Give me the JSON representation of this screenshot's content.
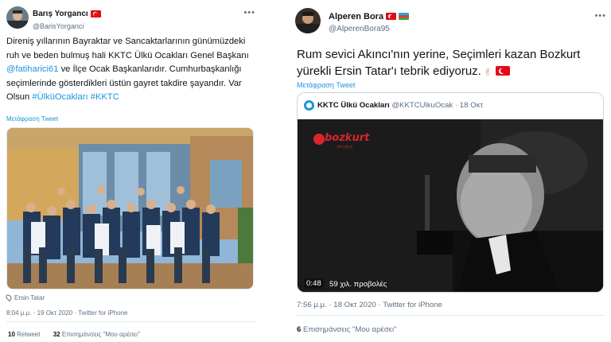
{
  "tweet1": {
    "display_name": "Barış Yorgancı",
    "handle": "@BarisYorganci",
    "text_parts": [
      "Direniş yıllarının Bayraktar ve Sancaktarlarının günümüzdeki ruh ve beden bulmuş hali KKTC Ülkü Ocakları Genel Başkanı ",
      "@fatiharici61",
      " ve İlçe Ocak Başkanlarıdır. Cumhurbaşkanlığı seçimlerinde gösterdikleri üstün gayret takdire şayandır. Var Olsun ",
      "#ÜlküOcakları",
      " ",
      "#KKTC"
    ],
    "translate_label": "Μετάφραση Tweet",
    "place": "Ersin Tatar",
    "time": "8:04 μ.μ.",
    "date": "19 Οκτ 2020",
    "source": "Twitter for iPhone",
    "retweets_count": "10",
    "retweets_label": "Retweet",
    "likes_count": "32",
    "likes_label": "Επισημάνσεις \"Μου αρέσει\""
  },
  "tweet2": {
    "display_name": "Alperen Bora",
    "handle": "@AlperenBora95",
    "text_line1": "Rum sevici Akıncı'nın yerine, Seçimleri kazan Bozkurt",
    "text_line2": "yürekli Ersin Tatar'ı tebrik ediyoruz.",
    "translate_label": "Μετάφραση Tweet",
    "quote": {
      "display_name": "KKTC Ülkü Ocakları",
      "handle": "@KKTCUlkuOcak",
      "date": "18 Οκτ",
      "video_logo": "bozkurt",
      "video_logo_sub": "medya",
      "video_time": "0:48",
      "video_views": "59 χιλ. προβολές"
    },
    "time": "7:56 μ.μ.",
    "date": "18 Οκτ 2020",
    "source": "Twitter for iPhone",
    "likes_count": "6",
    "likes_label": "Επισημάνσεις \"Μου αρέσει\""
  },
  "icons": {
    "more": "more-horizontal-icon",
    "place": "location-pin-icon",
    "flag_tr": "turkey-flag-icon",
    "flag_az": "azerbaijan-flag-icon"
  },
  "colors": {
    "link": "#1b95e0",
    "secondary_text": "#5b7083",
    "border": "#e1e8ed"
  }
}
